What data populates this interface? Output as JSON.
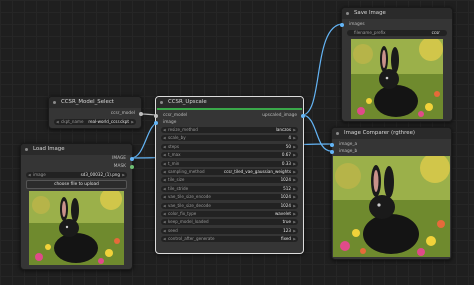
{
  "nodes": {
    "save_image": {
      "title": "Save Image",
      "input_label": "images",
      "widget": {
        "label": "filename_prefix",
        "value": "ccsr"
      }
    },
    "ccsr_model_select": {
      "title": "CCSR_Model_Select",
      "output_label": "ccsr_model",
      "widget": {
        "label": "ckpt_name",
        "value": "real-world_ccsr.ckpt"
      }
    },
    "ccsr_upscale": {
      "title": "CCSR_Upscale",
      "inputs": [
        "ccsr_model",
        "image"
      ],
      "output_label": "upscaled_image",
      "progress_percent": 100,
      "widgets": [
        {
          "label": "resize_method",
          "value": "lanczos"
        },
        {
          "label": "scale_by",
          "value": "4"
        },
        {
          "label": "steps",
          "value": "50"
        },
        {
          "label": "t_max",
          "value": "0.67"
        },
        {
          "label": "t_min",
          "value": "0.33"
        },
        {
          "label": "sampling_method",
          "value": "ccsr_tiled_vae_gaussian_weights"
        },
        {
          "label": "tile_size",
          "value": "1024"
        },
        {
          "label": "tile_stride",
          "value": "512"
        },
        {
          "label": "vae_tile_size_encode",
          "value": "1024"
        },
        {
          "label": "vae_tile_size_decode",
          "value": "1024"
        },
        {
          "label": "color_fix_type",
          "value": "wavelet"
        },
        {
          "label": "keep_model_loaded",
          "value": "true"
        },
        {
          "label": "seed",
          "value": "123"
        },
        {
          "label": "control_after_generate",
          "value": "fixed"
        }
      ]
    },
    "load_image": {
      "title": "Load Image",
      "outputs": [
        "IMAGE",
        "MASK"
      ],
      "widget": {
        "label": "image",
        "value": "sd3_00032_(1).png"
      },
      "upload_label": "choose file to upload"
    },
    "image_compare": {
      "title": "Image Comparer (rgthree)",
      "inputs": [
        "image_a",
        "image_b"
      ]
    }
  },
  "colors": {
    "image_wire": "#64b5f6",
    "model_wire": "#c8c8c8",
    "image_socket": "#64b5f6",
    "selected_border": "#dcdcdc",
    "progress": "#3aa84a"
  },
  "images": {
    "subject": "black rabbit in flower field"
  }
}
